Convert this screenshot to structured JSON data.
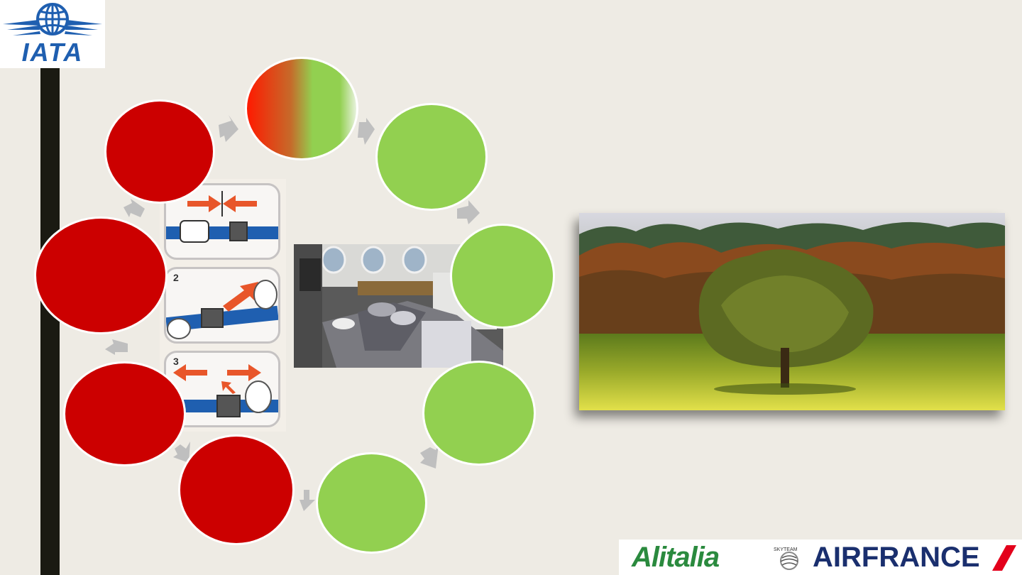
{
  "logos": {
    "iata": "IATA",
    "alitalia": "Alitalia",
    "airfrance": "AIRFRANCE",
    "skyteam": "SKYTEAM"
  },
  "seatbelt_steps": [
    "",
    "2",
    "3"
  ],
  "cycle": {
    "colors": {
      "red": "#cc0000",
      "green": "#92d050",
      "arrow": "#bfbfbf"
    }
  }
}
